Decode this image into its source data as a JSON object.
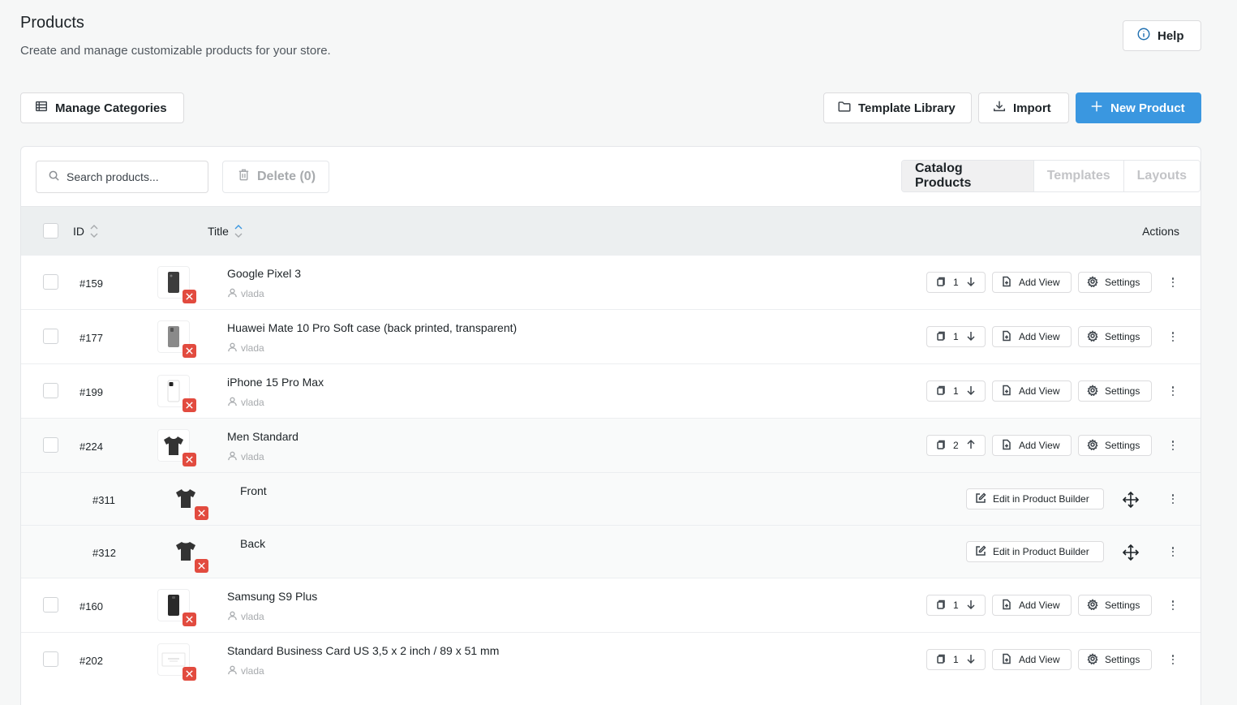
{
  "header": {
    "title": "Products",
    "subtitle": "Create and manage customizable products for your store.",
    "help_label": "Help"
  },
  "toolbar": {
    "manage_categories_label": "Manage Categories",
    "template_library_label": "Template Library",
    "import_label": "Import",
    "new_product_label": "New Product"
  },
  "panel": {
    "search_placeholder": "Search products...",
    "delete_label": "Delete (0)",
    "tabs": [
      {
        "label": "Catalog Products",
        "active": true
      },
      {
        "label": "Templates",
        "active": false
      },
      {
        "label": "Layouts",
        "active": false
      }
    ]
  },
  "table": {
    "columns": {
      "id": "ID",
      "title": "Title",
      "actions": "Actions"
    },
    "add_view_label": "Add View",
    "settings_label": "Settings",
    "edit_builder_label": "Edit in Product Builder",
    "rows": [
      {
        "id": "#159",
        "title": "Google Pixel 3",
        "author": "vlada",
        "views": "1",
        "expanded": false
      },
      {
        "id": "#177",
        "title": "Huawei Mate 10 Pro Soft case (back printed, transparent)",
        "author": "vlada",
        "views": "1",
        "expanded": false
      },
      {
        "id": "#199",
        "title": "iPhone 15 Pro Max",
        "author": "vlada",
        "views": "1",
        "expanded": false
      },
      {
        "id": "#224",
        "title": "Men Standard",
        "author": "vlada",
        "views": "2",
        "expanded": true
      },
      {
        "id": "#160",
        "title": "Samsung S9 Plus",
        "author": "vlada",
        "views": "1",
        "expanded": false
      },
      {
        "id": "#202",
        "title": "Standard Business Card US 3,5 x 2 inch / 89 x 51 mm",
        "author": "vlada",
        "views": "1",
        "expanded": false
      }
    ],
    "subrows": [
      {
        "id": "#311",
        "title": "Front"
      },
      {
        "id": "#312",
        "title": "Back"
      }
    ]
  },
  "colors": {
    "accent": "#3a97e0",
    "danger": "#e24b3f",
    "help_icon": "#2271b1"
  },
  "icons": {
    "help": "info-icon",
    "manage_categories": "table-list-icon",
    "template_library": "folder-icon",
    "import": "download-icon",
    "new_product": "plus-icon",
    "search": "search-icon",
    "delete": "trash-icon",
    "views": "copy-icon",
    "add_view": "file-plus-icon",
    "settings": "gear-icon",
    "edit": "edit-icon",
    "move": "move-arrows-icon",
    "more": "kebab-icon",
    "remove_image": "close-icon",
    "author": "user-icon"
  }
}
